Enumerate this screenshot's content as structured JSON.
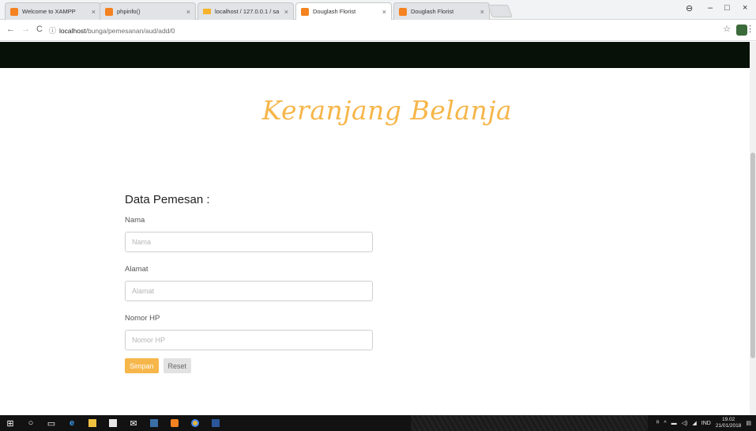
{
  "browser": {
    "tabs": [
      {
        "title": "Welcome to XAMPP",
        "active": false
      },
      {
        "title": "phpinfo()",
        "active": false
      },
      {
        "title": "localhost / 127.0.0.1 / sa",
        "active": false
      },
      {
        "title": "Douglash Florist",
        "active": true
      },
      {
        "title": "Douglash Florist",
        "active": false
      }
    ],
    "address": {
      "host": "localhost",
      "path": "/bunga/pemesanan/aud/add/0"
    }
  },
  "page": {
    "title": "Keranjang Belanja",
    "form": {
      "heading": "Data Pemesan :",
      "fields": {
        "nama": {
          "label": "Nama",
          "placeholder": "Nama",
          "value": ""
        },
        "alamat": {
          "label": "Alamat",
          "placeholder": "Alamat",
          "value": ""
        },
        "nomor_hp": {
          "label": "Nomor HP",
          "placeholder": "Nomor HP",
          "value": ""
        }
      },
      "buttons": {
        "submit": "Simpan",
        "reset": "Reset"
      }
    }
  },
  "colors": {
    "accent": "#f6b64a",
    "navbar": "#071108"
  },
  "taskbar": {
    "tray": {
      "language": "IND",
      "time": "19.02",
      "date": "21/01/2018"
    }
  }
}
